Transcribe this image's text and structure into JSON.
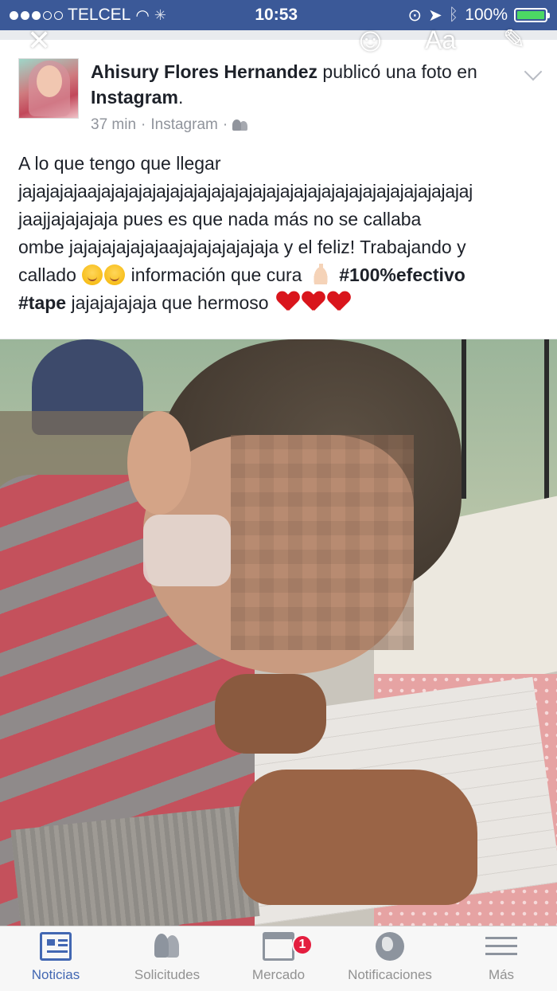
{
  "status_bar": {
    "carrier": "TELCEL",
    "time": "10:53",
    "battery": "100%"
  },
  "overlay": {
    "close": "✕",
    "emoji": "☺",
    "text_tool": "Aa",
    "pen": "✎"
  },
  "post": {
    "author": "Ahisury Flores Hernandez",
    "action": "publicó una foto en",
    "source": "Instagram",
    "time": "37 min",
    "via": "Instagram",
    "separator": "·",
    "lines": [
      "A lo que tengo que llegar",
      "jajajajajaajajajajajajajajajajajajajajajajajajajajajajajajajajajaj",
      "jaajjajajajaja pues es que nada más no se callaba",
      "ombe jajajajajajajaajajajajajajaja y el feliz! Trabajando y"
    ],
    "line5_a": "callado",
    "line5_b": "información que cura",
    "hashtag1": "#100%efectivo",
    "hashtag2": "#tape",
    "line6_text": "jajajajajaja que hermoso"
  },
  "tab_bar": {
    "tabs": [
      {
        "label": "Noticias",
        "icon": "news-feed-icon"
      },
      {
        "label": "Solicitudes",
        "icon": "friend-requests-icon"
      },
      {
        "label": "Mercado",
        "icon": "marketplace-icon"
      },
      {
        "label": "Notificaciones",
        "icon": "globe-icon"
      },
      {
        "label": "Más",
        "icon": "menu-icon"
      }
    ],
    "market_badge": "1"
  },
  "colors": {
    "facebook_blue": "#3b5998",
    "active_tab": "#4267b2",
    "badge_red": "#e41e3f",
    "heart_red": "#d9151c"
  }
}
